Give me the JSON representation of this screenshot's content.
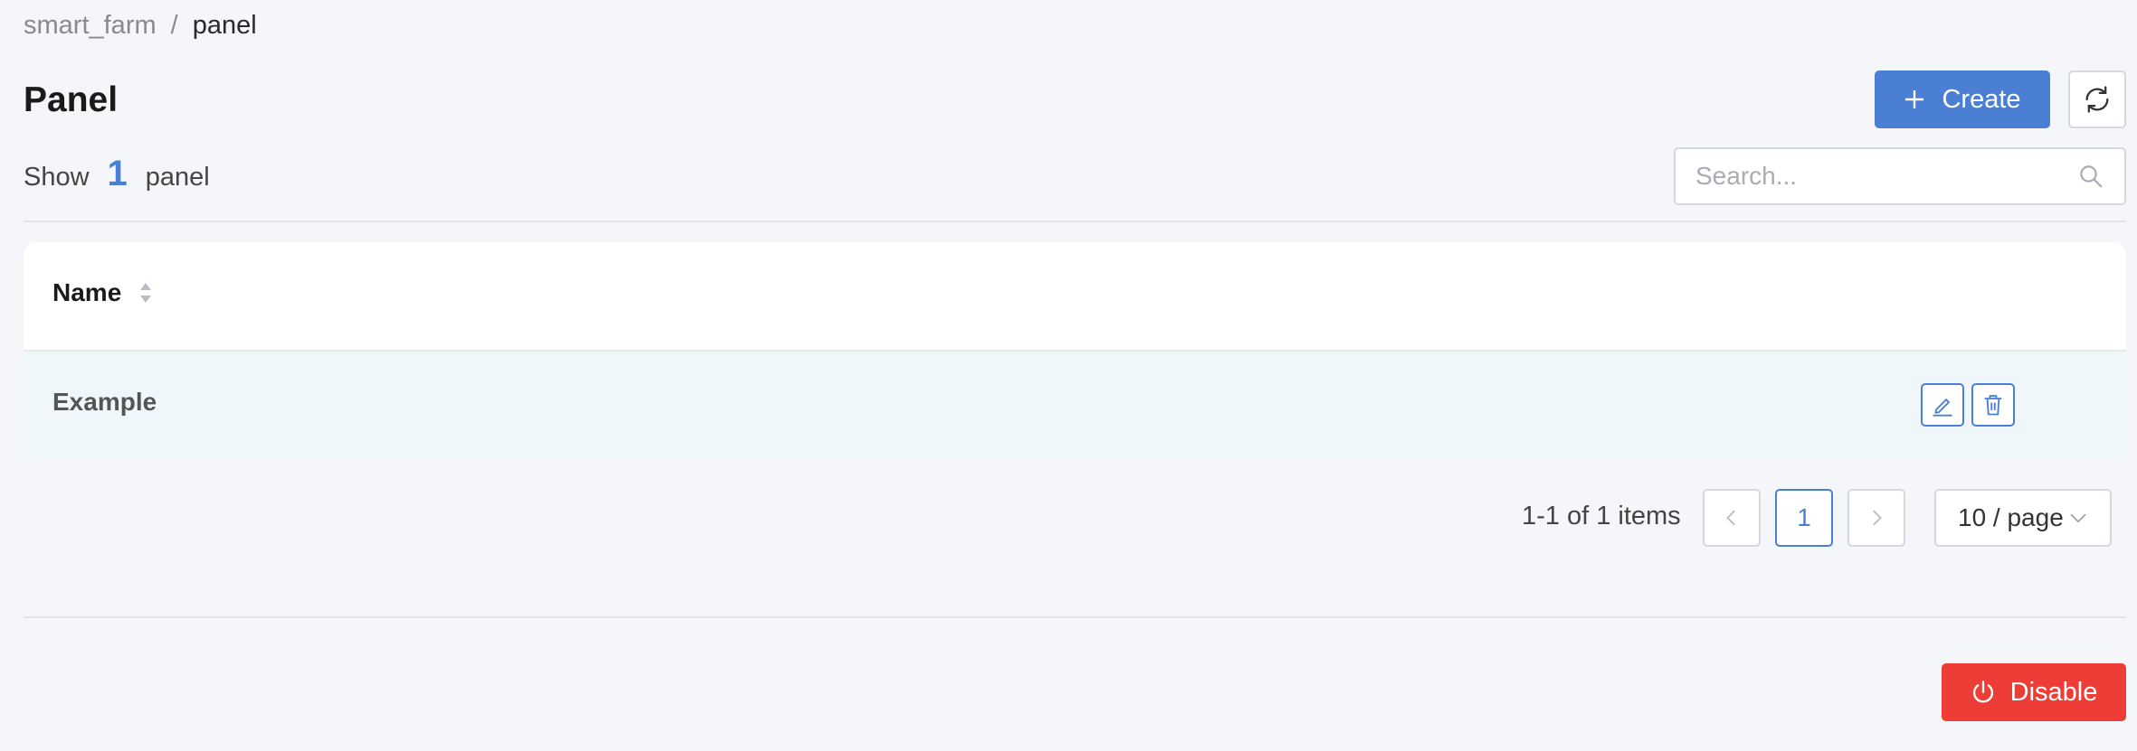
{
  "breadcrumb": {
    "parent": "smart_farm",
    "separator": "/",
    "current": "panel"
  },
  "page": {
    "title": "Panel"
  },
  "toolbar": {
    "create_label": "Create"
  },
  "summary": {
    "show_label": "Show",
    "count": "1",
    "unit_label": "panel"
  },
  "search": {
    "placeholder": "Search..."
  },
  "table": {
    "columns": [
      "Name"
    ],
    "rows": [
      {
        "name": "Example"
      }
    ]
  },
  "pagination": {
    "info": "1-1 of 1 items",
    "current_page": "1",
    "page_size": "10 / page"
  },
  "footer": {
    "disable_label": "Disable"
  },
  "colors": {
    "primary": "#4a7fd4",
    "danger": "#ee3d36",
    "background": "#f4f6fa",
    "row_highlight": "#f0f7fb"
  }
}
